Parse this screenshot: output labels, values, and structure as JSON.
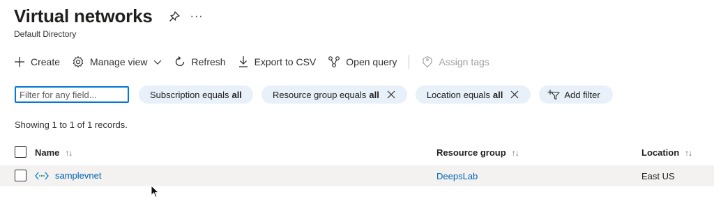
{
  "header": {
    "title": "Virtual networks",
    "subtitle": "Default Directory",
    "more_label": "···"
  },
  "toolbar": {
    "create": "Create",
    "manage_view": "Manage view",
    "refresh": "Refresh",
    "export_csv": "Export to CSV",
    "open_query": "Open query",
    "assign_tags": "Assign tags"
  },
  "filters": {
    "search_placeholder": "Filter for any field...",
    "subscription": {
      "label": "Subscription equals",
      "value": "all"
    },
    "resource_group": {
      "label": "Resource group equals",
      "value": "all"
    },
    "location": {
      "label": "Location equals",
      "value": "all"
    },
    "add_filter": "Add filter"
  },
  "records_text": "Showing 1 to 1 of 1 records.",
  "table": {
    "columns": [
      {
        "label": "Name",
        "sort": "↑↓"
      },
      {
        "label": "Resource group",
        "sort": "↑↓"
      },
      {
        "label": "Location",
        "sort": "↑↓"
      }
    ],
    "rows": [
      {
        "name": "samplevnet",
        "resource_group": "DeepsLab",
        "location": "East US"
      }
    ]
  },
  "colors": {
    "accent": "#0078d4",
    "link": "#0063b1",
    "pill": "#e8f0fa",
    "row_bg": "#f3f2f1"
  },
  "icons": [
    "pin-icon",
    "plus-icon",
    "gear-icon",
    "chevron-down-icon",
    "refresh-icon",
    "download-icon",
    "query-icon",
    "tag-icon",
    "close-icon",
    "add-filter-icon",
    "vnet-icon",
    "mouse-cursor-icon"
  ]
}
